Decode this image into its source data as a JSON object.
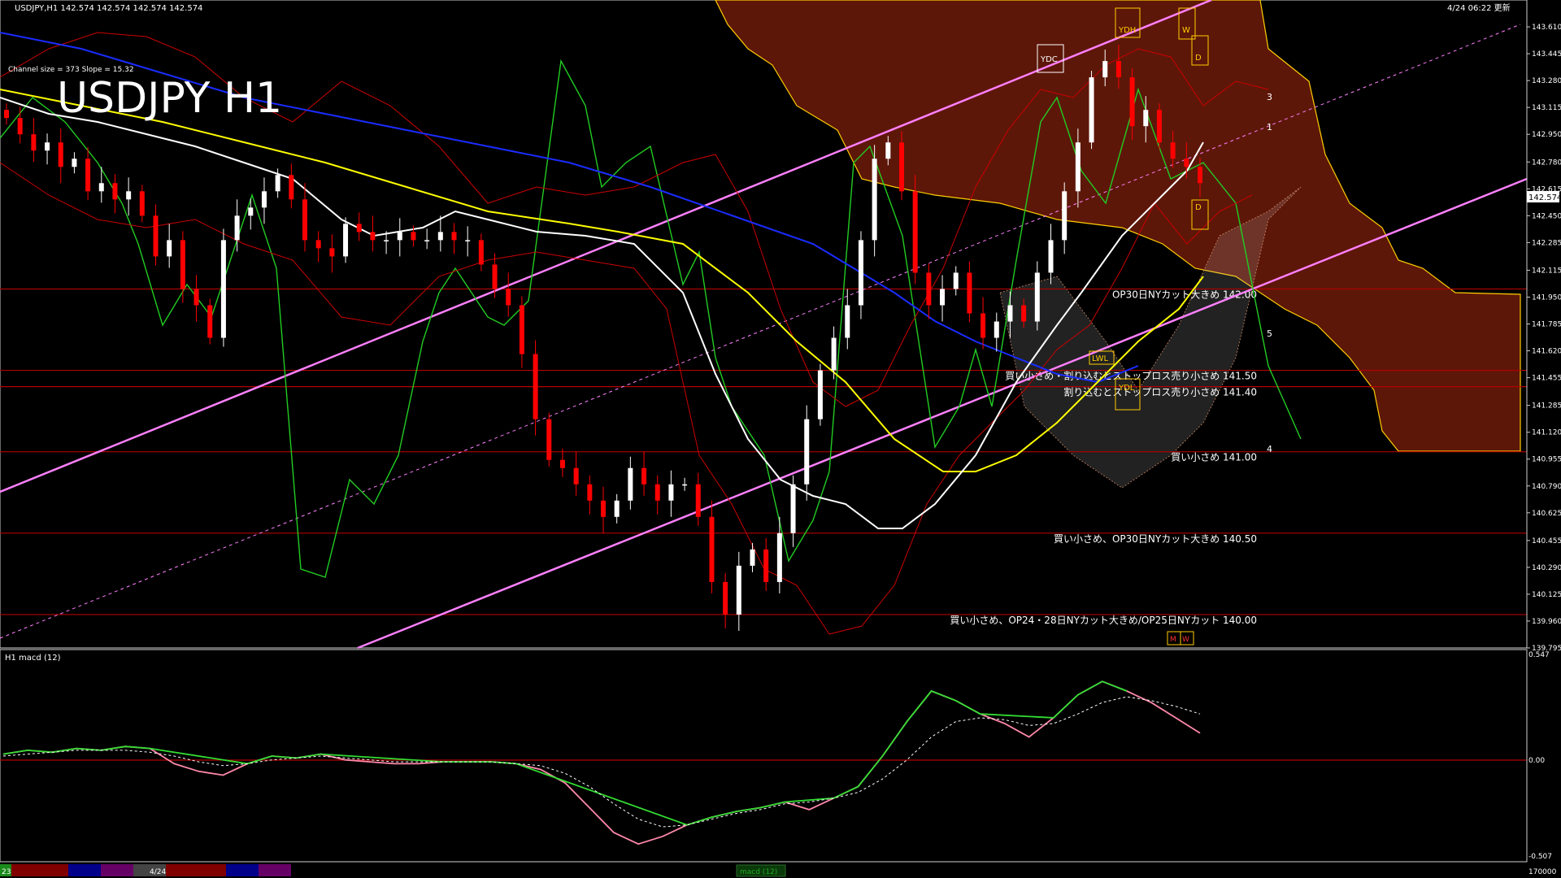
{
  "header": {
    "info": "USDJPY,H1  142.574 142.574 142.574 142.574",
    "channel_info": "Channel size = 373 Slope = 15.32",
    "symbol_title": "USDJPY H1",
    "timestamp": "4/24 06:22 更新"
  },
  "colors": {
    "background": "#000000",
    "bull_candle": "#ffffff",
    "bear_candle": "#ff0000",
    "ma_white": "#ffffff",
    "ma_yellow": "#ffff00",
    "ma_blue": "#1a2cff",
    "channel": "#ff80ff",
    "chikou": "#22cc22",
    "bands": "#cc0000",
    "kumo": "#aa2a10",
    "level_line": "#b30000",
    "macd_up": "#33dd33",
    "macd_down": "#ff88aa"
  },
  "chart_data": [
    {
      "type": "candlestick",
      "symbol": "USDJPY",
      "timeframe": "H1",
      "ylim": [
        139.795,
        143.775
      ],
      "ytick_labels": [
        "143.610",
        "143.445",
        "143.280",
        "143.115",
        "142.950",
        "142.780",
        "142.615",
        "142.450",
        "142.285",
        "142.115",
        "141.950",
        "141.785",
        "141.620",
        "141.455",
        "141.285",
        "141.120",
        "140.955",
        "140.790",
        "140.625",
        "140.455",
        "140.290",
        "140.125",
        "139.960",
        "139.795"
      ],
      "current_price": "142.574",
      "close_path": [
        143.05,
        142.95,
        142.85,
        142.9,
        142.75,
        142.8,
        142.6,
        142.65,
        142.55,
        142.6,
        142.45,
        142.2,
        142.3,
        142.0,
        141.9,
        141.7,
        142.3,
        142.45,
        142.5,
        142.6,
        142.7,
        142.55,
        142.3,
        142.25,
        142.2,
        142.4,
        142.35,
        142.3,
        142.3,
        142.35,
        142.3,
        142.3,
        142.35,
        142.3,
        142.3,
        142.15,
        142.0,
        141.9,
        141.6,
        141.2,
        140.95,
        140.9,
        140.8,
        140.7,
        140.6,
        140.7,
        140.9,
        140.8,
        140.7,
        140.8,
        140.8,
        140.6,
        140.2,
        140.0,
        140.3,
        140.4,
        140.2,
        140.5,
        140.8,
        141.2,
        141.5,
        141.7,
        141.9,
        142.3,
        142.8,
        142.9,
        142.6,
        142.1,
        141.9,
        142.0,
        142.1,
        141.85,
        141.7,
        141.8,
        141.9,
        141.8,
        142.1,
        142.3,
        142.6,
        142.9,
        143.3,
        143.4,
        143.3,
        143.0,
        143.1,
        142.9,
        142.8,
        142.75,
        142.65
      ],
      "levels": [
        {
          "price": 142.0,
          "label": "OP30日NYカット大きめ 142.00"
        },
        {
          "price": 141.5,
          "label": "買い小さめ・割り込むとストップロス売り小さめ 141.50"
        },
        {
          "price": 141.4,
          "label": "割り込むとストップロス売り小さめ 141.40"
        },
        {
          "price": 141.0,
          "label": "買い小さめ 141.00"
        },
        {
          "price": 140.5,
          "label": "買い小さめ、OP30日NYカット大きめ 140.50"
        },
        {
          "price": 140.0,
          "label": "買い小さめ、OP24・28日NYカット大きめ/OP25日NYカット 140.00"
        }
      ],
      "box_labels": [
        "YDH",
        "YDC",
        "YDL",
        "LWL",
        "W",
        "D",
        "M"
      ],
      "channel_numbers": [
        "1",
        "3",
        "5",
        "4"
      ]
    },
    {
      "type": "line",
      "title": "H1  macd (12)",
      "ylim": [
        -0.507,
        0.547
      ],
      "ytick_labels": [
        "0.547",
        "0.00",
        "-0.507"
      ],
      "macd": [
        0.03,
        0.05,
        0.04,
        0.06,
        0.05,
        0.07,
        0.06,
        -0.02,
        -0.06,
        -0.08,
        -0.02,
        0.02,
        0.01,
        0.03,
        0.0,
        -0.01,
        -0.02,
        -0.02,
        -0.01,
        -0.01,
        -0.01,
        -0.02,
        -0.05,
        -0.12,
        -0.25,
        -0.38,
        -0.44,
        -0.4,
        -0.34,
        -0.3,
        -0.27,
        -0.25,
        -0.22,
        -0.26,
        -0.2,
        -0.14,
        0.02,
        0.2,
        0.36,
        0.31,
        0.24,
        0.19,
        0.12,
        0.22,
        0.34,
        0.41,
        0.36,
        0.3,
        0.22,
        0.14
      ],
      "signal": [
        0.02,
        0.03,
        0.04,
        0.05,
        0.05,
        0.05,
        0.04,
        0.02,
        -0.01,
        -0.03,
        -0.02,
        0.0,
        0.01,
        0.02,
        0.01,
        0.0,
        -0.01,
        -0.01,
        -0.01,
        -0.01,
        -0.01,
        -0.02,
        -0.03,
        -0.07,
        -0.14,
        -0.23,
        -0.31,
        -0.35,
        -0.34,
        -0.31,
        -0.28,
        -0.26,
        -0.23,
        -0.22,
        -0.2,
        -0.17,
        -0.1,
        0.0,
        0.12,
        0.2,
        0.22,
        0.21,
        0.18,
        0.19,
        0.24,
        0.3,
        0.33,
        0.31,
        0.28,
        0.24
      ],
      "footer_tag": "macd (12)"
    }
  ],
  "timeline": {
    "left_label": "23",
    "date_label": "4/24",
    "right_label": "170000"
  }
}
